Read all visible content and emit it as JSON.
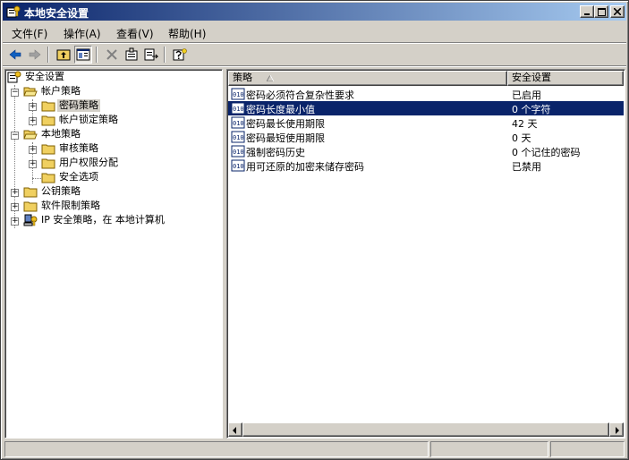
{
  "window": {
    "title": "本地安全设置"
  },
  "menu": {
    "items": [
      {
        "label": "文件(F)"
      },
      {
        "label": "操作(A)"
      },
      {
        "label": "查看(V)"
      },
      {
        "label": "帮助(H)"
      }
    ]
  },
  "tree": {
    "root": "安全设置",
    "nodes": [
      {
        "label": "帐户策略",
        "expander": "−"
      },
      {
        "label": "密码策略",
        "expander": "+"
      },
      {
        "label": "帐户锁定策略",
        "expander": "+"
      },
      {
        "label": "本地策略",
        "expander": "−"
      },
      {
        "label": "审核策略",
        "expander": "+"
      },
      {
        "label": "用户权限分配",
        "expander": "+"
      },
      {
        "label": "安全选项",
        "expander": ""
      },
      {
        "label": "公钥策略",
        "expander": "+"
      },
      {
        "label": "软件限制策略",
        "expander": "+"
      },
      {
        "label": "IP 安全策略，在 本地计算机",
        "expander": "+"
      }
    ]
  },
  "list": {
    "columns": [
      "策略",
      "安全设置"
    ],
    "rows": [
      {
        "name": "密码必须符合复杂性要求",
        "value": "已启用"
      },
      {
        "name": "密码长度最小值",
        "value": "0 个字符"
      },
      {
        "name": "密码最长使用期限",
        "value": "42 天"
      },
      {
        "name": "密码最短使用期限",
        "value": "0 天"
      },
      {
        "name": "强制密码历史",
        "value": "0 个记住的密码"
      },
      {
        "name": "用可还原的加密来储存密码",
        "value": "已禁用"
      }
    ]
  },
  "colors": {
    "title_bar": "#0a246a",
    "selection": "#0a246a",
    "face": "#d4d0c8"
  }
}
